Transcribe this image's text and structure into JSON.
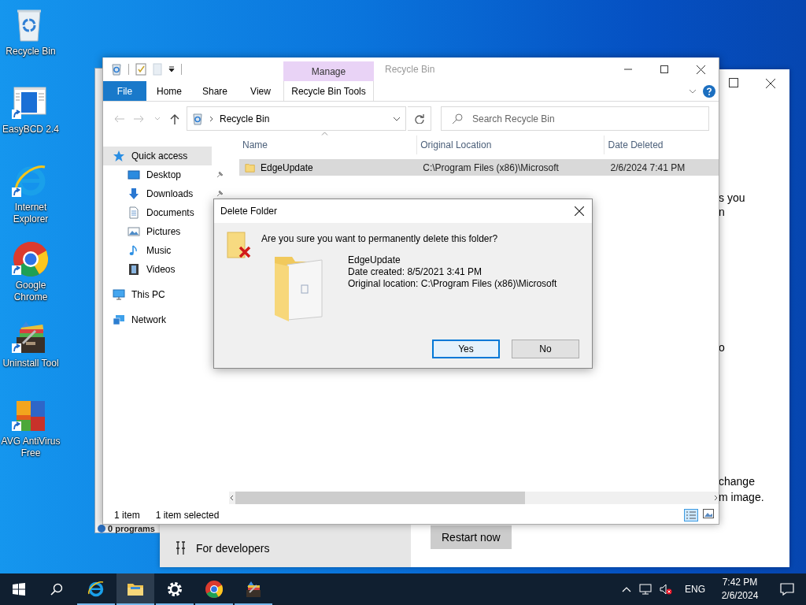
{
  "desktop_icons": [
    {
      "label": "Recycle Bin",
      "kind": "recycle-bin",
      "shortcut": false
    },
    {
      "label": "EasyBCD 2.4",
      "kind": "app-window",
      "shortcut": true
    },
    {
      "label": "Internet Explorer",
      "kind": "ie",
      "shortcut": true
    },
    {
      "label": "Google Chrome",
      "kind": "chrome",
      "shortcut": true
    },
    {
      "label": "Uninstall Tool",
      "kind": "uninstaller",
      "shortcut": true
    },
    {
      "label": "AVG AntiVirus Free",
      "kind": "avg",
      "shortcut": true
    }
  ],
  "programs_window": {
    "status": "0 programs"
  },
  "settings_window": {
    "text_fragments": [
      "s you",
      "n",
      "o",
      "change",
      "m image."
    ],
    "nav_item": "For developers",
    "button": "Restart now"
  },
  "explorer": {
    "title": "Recycle Bin",
    "context_tab": "Manage",
    "ribbon_tabs": [
      {
        "label": "File",
        "kind": "file"
      },
      {
        "label": "Home",
        "kind": "tab"
      },
      {
        "label": "Share",
        "kind": "tab"
      },
      {
        "label": "View",
        "kind": "tab"
      },
      {
        "label": "Recycle Bin Tools",
        "kind": "context"
      }
    ],
    "address": "Recycle Bin",
    "search": {
      "placeholder": "Search Recycle Bin"
    },
    "nav": [
      {
        "label": "Quick access",
        "kind": "star",
        "selected": true,
        "children": [
          {
            "label": "Desktop",
            "kind": "desktop",
            "selected": false,
            "pinned": true
          },
          {
            "label": "Downloads",
            "kind": "download",
            "selected": false,
            "pinned": true
          },
          {
            "label": "Documents",
            "kind": "document",
            "selected": false
          },
          {
            "label": "Pictures",
            "kind": "picture",
            "selected": false
          },
          {
            "label": "Music",
            "kind": "music",
            "selected": false
          },
          {
            "label": "Videos",
            "kind": "video",
            "selected": false
          }
        ]
      },
      {
        "label": "This PC",
        "kind": "computer",
        "selected": false
      },
      {
        "label": "Network",
        "kind": "network",
        "selected": false
      }
    ],
    "columns": [
      {
        "label": "Name",
        "sorted": true
      },
      {
        "label": "Original Location",
        "sorted": false
      },
      {
        "label": "Date Deleted",
        "sorted": false
      }
    ],
    "rows": [
      {
        "name": "EdgeUpdate",
        "kind": "folder",
        "original_location": "C:\\Program Files (x86)\\Microsoft",
        "date_deleted": "2/6/2024 7:41 PM",
        "selected": true
      }
    ],
    "status": {
      "count": "1 item",
      "selection": "1 item selected"
    }
  },
  "dialog": {
    "title": "Delete Folder",
    "question": "Are you sure you want to permanently delete this folder?",
    "details": [
      "EdgeUpdate",
      "Date created: 8/5/2021 3:41 PM",
      "Original location: C:\\Program Files (x86)\\Microsoft"
    ],
    "buttons": [
      {
        "label": "Yes",
        "selected": true
      },
      {
        "label": "No",
        "selected": false
      }
    ]
  },
  "taskbar": {
    "apps": [
      {
        "kind": "ie",
        "running": true,
        "active": false
      },
      {
        "kind": "explorer",
        "running": true,
        "active": true
      },
      {
        "kind": "settings",
        "running": true,
        "active": false
      },
      {
        "kind": "chrome",
        "running": true,
        "active": false
      },
      {
        "kind": "uninstaller",
        "running": true,
        "active": false
      }
    ],
    "language": "ENG",
    "time": "7:42 PM",
    "date": "2/6/2024"
  }
}
